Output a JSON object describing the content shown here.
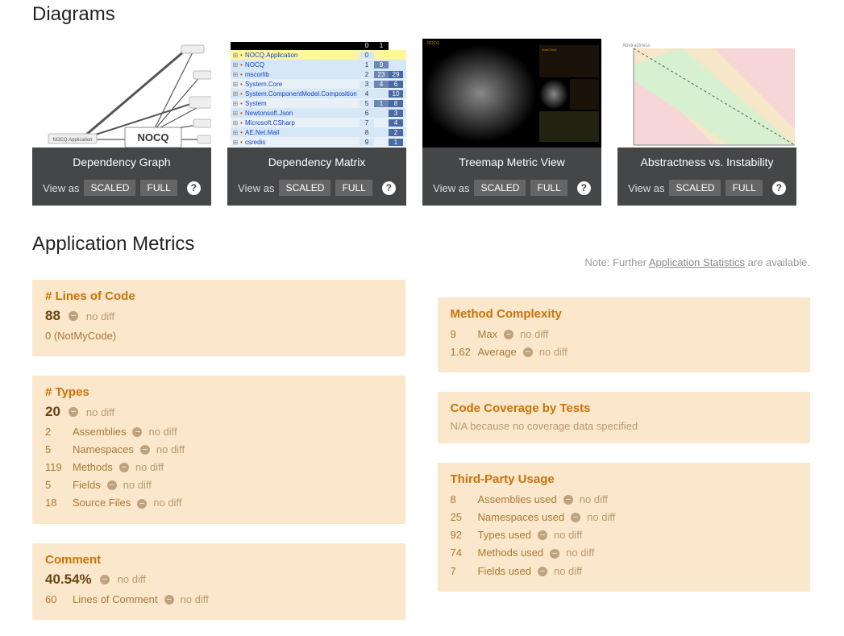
{
  "sections": {
    "diagrams": "Diagrams",
    "metrics": "Application Metrics"
  },
  "diagrams": [
    {
      "title": "Dependency Graph",
      "view_as": "View as",
      "scaled": "SCALED",
      "full": "FULL",
      "help": "?"
    },
    {
      "title": "Dependency Matrix",
      "view_as": "View as",
      "scaled": "SCALED",
      "full": "FULL",
      "help": "?"
    },
    {
      "title": "Treemap Metric View",
      "view_as": "View as",
      "scaled": "SCALED",
      "full": "FULL",
      "help": "?"
    },
    {
      "title": "Abstractness vs. Instability",
      "view_as": "View as",
      "scaled": "SCALED",
      "full": "FULL",
      "help": "?"
    }
  ],
  "matrix_items": [
    {
      "name": "NOCQ.Application",
      "a": "0",
      "b": ""
    },
    {
      "name": "NOCQ",
      "a": "1",
      "b": "9"
    },
    {
      "name": "mscorlib",
      "a": "2",
      "b": "23",
      "c": "29"
    },
    {
      "name": "System.Core",
      "a": "3",
      "b": "4",
      "c": "6"
    },
    {
      "name": "System.ComponentModel.Composition",
      "a": "4",
      "b": "",
      "c": "10"
    },
    {
      "name": "System",
      "a": "5",
      "b": "1",
      "c": "8"
    },
    {
      "name": "Newtonsoft.Json",
      "a": "6",
      "b": "",
      "c": "3"
    },
    {
      "name": "Microsoft.CSharp",
      "a": "7",
      "b": "",
      "c": "4"
    },
    {
      "name": "AE.Net.Mail",
      "a": "8",
      "b": "",
      "c": "2"
    },
    {
      "name": "csredis",
      "a": "9",
      "b": "",
      "c": "1"
    }
  ],
  "note": {
    "prefix": "Note: Further ",
    "link": "Application Statistics",
    "suffix": " are available."
  },
  "no_diff": "no diff",
  "metrics": {
    "loc": {
      "title": "# Lines of Code",
      "value": "88",
      "sub": "0 (NotMyCode)"
    },
    "types": {
      "title": "# Types",
      "value": "20",
      "rows": [
        {
          "n": "2",
          "l": "Assemblies"
        },
        {
          "n": "5",
          "l": "Namespaces"
        },
        {
          "n": "119",
          "l": "Methods"
        },
        {
          "n": "5",
          "l": "Fields"
        },
        {
          "n": "18",
          "l": "Source Files"
        }
      ]
    },
    "comment": {
      "title": "Comment",
      "value": "40.54%",
      "rows": [
        {
          "n": "60",
          "l": "Lines of Comment"
        }
      ]
    },
    "complexity": {
      "title": "Method Complexity",
      "rows": [
        {
          "n": "9",
          "l": "Max"
        },
        {
          "n": "1.62",
          "l": "Average"
        }
      ]
    },
    "coverage": {
      "title": "Code Coverage by Tests",
      "note": "N/A because no coverage data specified"
    },
    "thirdparty": {
      "title": "Third-Party Usage",
      "rows": [
        {
          "n": "8",
          "l": "Assemblies used"
        },
        {
          "n": "25",
          "l": "Namespaces used"
        },
        {
          "n": "92",
          "l": "Types used"
        },
        {
          "n": "74",
          "l": "Methods used"
        },
        {
          "n": "7",
          "l": "Fields used"
        }
      ]
    }
  }
}
